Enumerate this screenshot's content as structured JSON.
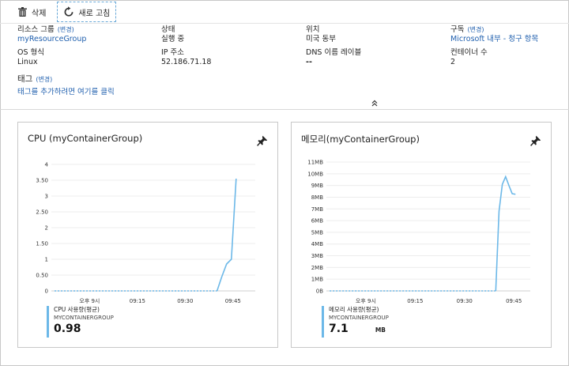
{
  "toolbar": {
    "delete_label": "삭제",
    "refresh_label": "새로 고침"
  },
  "essentials": {
    "resource_group": {
      "label": "리소스 그룹",
      "edit": "(변경)",
      "value": "myResourceGroup"
    },
    "status": {
      "label": "상태",
      "value": "실행 중"
    },
    "location": {
      "label": "위치",
      "value": "미국 동부"
    },
    "subscription": {
      "label": "구독",
      "edit": "(변경)",
      "value": "Microsoft 내부 - 청구 항목"
    },
    "os_type": {
      "label": "OS 형식",
      "value": "Linux"
    },
    "ip_address": {
      "label": "IP 주소",
      "value": "52.186.71.18"
    },
    "dns_label": {
      "label": "DNS 이름 레이블",
      "value": "--"
    },
    "container_count": {
      "label": "컨테이너 수",
      "value": "2"
    },
    "tags": {
      "label": "태그",
      "edit": "(변경)",
      "value": "태그를 추가하려면 여기를 클릭"
    }
  },
  "icons": {
    "delete": "trash-icon",
    "refresh": "refresh-icon",
    "collapse": "chevron-up-double-icon",
    "pin": "pin-icon"
  },
  "colors": {
    "series": "#6cb8e8",
    "link": "#1f5fae",
    "refresh_border": "#6aa9d8"
  },
  "chart_data": [
    {
      "type": "line",
      "title": "CPU (myContainerGroup)",
      "y_ticks": [
        "4",
        "3.50",
        "3",
        "2.50",
        "2",
        "1.50",
        "1",
        "0.50",
        "0"
      ],
      "ylim": [
        0,
        4
      ],
      "x_ticks": [
        "오후 9시",
        "09:15",
        "09:30",
        "09:45"
      ],
      "x_tick_minutes": [
        0,
        15,
        30,
        45
      ],
      "xlim_minutes": [
        -12,
        52
      ],
      "series": [
        {
          "name": "CPU 사용량(평균)",
          "x_minutes": [
            -11,
            -5,
            0,
            5,
            10,
            15,
            20,
            25,
            30,
            35,
            40,
            41.5,
            43,
            44.5,
            46
          ],
          "values": [
            0,
            0,
            0,
            0,
            0,
            0,
            0,
            0,
            0,
            0,
            0,
            0.45,
            0.85,
            1.0,
            3.55
          ]
        }
      ],
      "legend": {
        "name": "CPU 사용량(평균)",
        "resource": "MYCONTAINERGROUP",
        "value": "0.98",
        "unit": ""
      }
    },
    {
      "type": "line",
      "title": "메모리(myContainerGroup)",
      "y_ticks": [
        "11MB",
        "10MB",
        "9MB",
        "8MB",
        "7MB",
        "6MB",
        "5MB",
        "4MB",
        "3MB",
        "2MB",
        "1MB",
        "0B"
      ],
      "ylim": [
        0,
        11
      ],
      "x_ticks": [
        "오후 9시",
        "09:15",
        "09:30",
        "09:45"
      ],
      "x_tick_minutes": [
        0,
        15,
        30,
        45
      ],
      "xlim_minutes": [
        -12,
        50
      ],
      "series": [
        {
          "name": "메모리 사용량(평균)",
          "x_minutes": [
            -11,
            -5,
            0,
            5,
            10,
            15,
            20,
            25,
            30,
            35,
            39.5,
            40.5,
            41.5,
            42.5,
            43.5,
            44.5,
            45.5
          ],
          "values": [
            0,
            0,
            0,
            0,
            0,
            0,
            0,
            0,
            0,
            0,
            0,
            6.8,
            9.1,
            9.75,
            9.0,
            8.3,
            8.25
          ]
        }
      ],
      "legend": {
        "name": "메모리 사용량(평균)",
        "resource": "MYCONTAINERGROUP",
        "value": "7.1",
        "unit": "MB"
      }
    }
  ]
}
